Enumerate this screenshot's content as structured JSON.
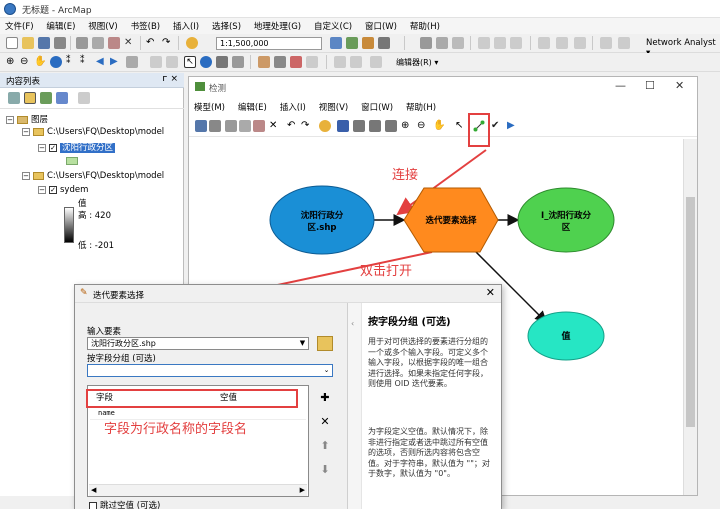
{
  "app": {
    "title": "无标题 - ArcMap"
  },
  "menubar": {
    "items": [
      "文件(F)",
      "编辑(E)",
      "视图(V)",
      "书签(B)",
      "插入(I)",
      "选择(S)",
      "地理处理(G)",
      "自定义(C)",
      "窗口(W)",
      "帮助(H)"
    ]
  },
  "toolbar": {
    "scale": "1:1,500,000",
    "network_analyst": "Network Analyst ▾",
    "editor": "编辑器(R) ▾"
  },
  "toc": {
    "title": "内容列表",
    "pin": "ᴦ ×",
    "layers_root": "图层",
    "folder1": "C:\\Users\\FQ\\Desktop\\model",
    "layer1": "沈阳行政分区",
    "folder2": "C:\\Users\\FQ\\Desktop\\model",
    "layer2": "sydem",
    "legend_value": "值",
    "legend_high": "高 : 420",
    "legend_low": "低 : -201"
  },
  "model_window": {
    "title": "检测",
    "menubar": [
      "模型(M)",
      "编辑(E)",
      "插入(I)",
      "视图(V)",
      "窗口(W)",
      "帮助(H)"
    ],
    "nodes": {
      "input": "沈阳行政分\n区.shp",
      "tool": "迭代要素选择",
      "output": "I_沈阳行政分\n区",
      "value": "值"
    }
  },
  "annotations": {
    "connect": "连接",
    "double_click": "双击打开",
    "field_note": "字段为行政名称的字段名"
  },
  "dialog": {
    "title": "迭代要素选择",
    "input_label": "输入要素",
    "input_value": "沈阳行政分区.shp",
    "group_label": "按字段分组 (可选)",
    "group_value": "",
    "grid_header_field": "字段",
    "grid_header_null": "空值",
    "grid_row_field": "name",
    "skip_label": "跳过空值 (可选)",
    "help_title": "按字段分组 (可选)",
    "help_p1": "用于对可供选择的要素进行分组的一个或多个输入字段。可定义多个输入字段，以根据字段的唯一组合进行选择。如果未指定任何字段，则使用 OID 迭代要素。",
    "help_p2": "为字段定义空值。默认情况下，除非进行指定或者选中跳过所有空值的选项，否则所选内容将包含空值。对于字符串，默认值为 \"\"；对于数字，默认值为 \"0\"。"
  },
  "colors": {
    "input_node": "#1a8fd6",
    "tool_node": "#ff8a1e",
    "output_node": "#4fd14f",
    "value_node": "#26e6c4",
    "annotation": "#e34040"
  }
}
